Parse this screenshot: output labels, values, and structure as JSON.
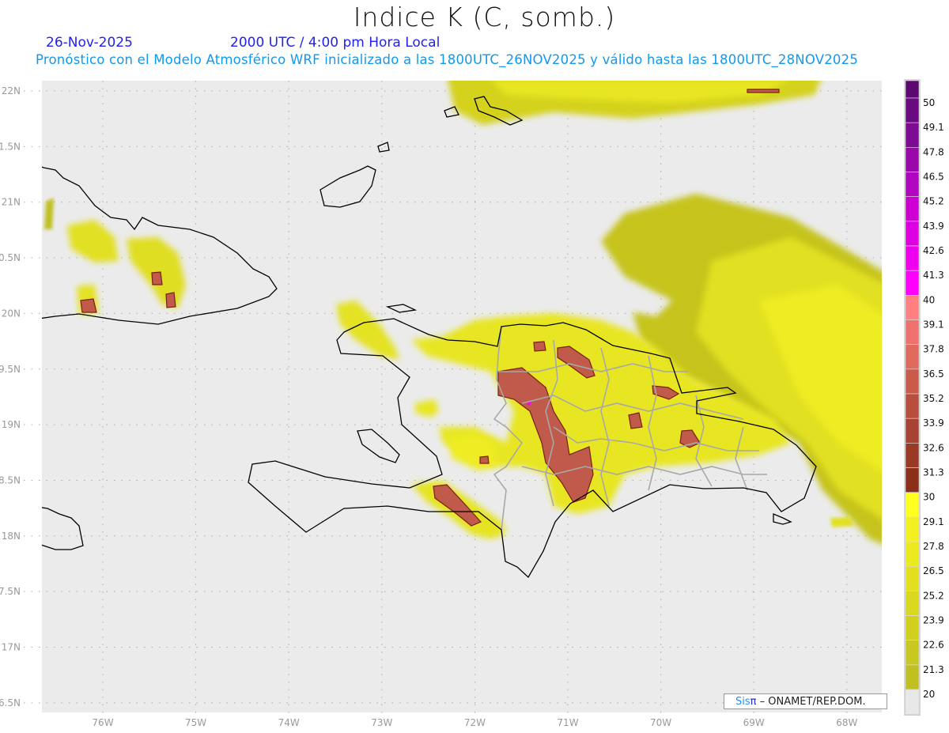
{
  "header": {
    "title": "Indice K (C, somb.)",
    "date": "26-Nov-2025",
    "time": "2000 UTC / 4:00 pm Hora Local",
    "subtitle": "Pronóstico con el Modelo Atmosférico WRF inicializado a las 1800UTC_26NOV2025 y válido hasta las  1800UTC_28NOV2025"
  },
  "map": {
    "lat_labels": [
      "22N",
      "1.5N",
      "21N",
      "0.5N",
      "20N",
      "9.5N",
      "19N",
      "8.5N",
      "18N",
      "7.5N",
      "17N",
      "6.5N"
    ],
    "lon_labels": [
      "76W",
      "75W",
      "74W",
      "73W",
      "72W",
      "71W",
      "70W",
      "69W",
      "68W"
    ],
    "ocean_color": "#ebebeb",
    "coast_color": "#000000",
    "province_color": "#a8a8a8"
  },
  "colorbar": {
    "labels": [
      "50",
      "49.1",
      "47.8",
      "46.5",
      "45.2",
      "43.9",
      "42.6",
      "41.3",
      "40",
      "39.1",
      "37.8",
      "36.5",
      "35.2",
      "33.9",
      "32.6",
      "31.3",
      "30",
      "29.1",
      "27.8",
      "26.5",
      "25.2",
      "23.9",
      "22.6",
      "21.3",
      "20"
    ],
    "colors": [
      "#5c0870",
      "#6a0a80",
      "#7c0a92",
      "#9a08aa",
      "#b006c0",
      "#cc00d2",
      "#dd00e2",
      "#ee00ee",
      "#ff00ff",
      "#ff8080",
      "#f07070",
      "#e06a5e",
      "#cc5a4a",
      "#b84e3e",
      "#a84232",
      "#983a26",
      "#8a3018",
      "#ffff20",
      "#f2f020",
      "#eaea1e",
      "#e2e01e",
      "#dad81e",
      "#d2d01e",
      "#c8c820",
      "#c0c020",
      "#e8e8e8"
    ]
  },
  "credit": {
    "sis": "Sis",
    "pi": "π",
    "org": " – ONAMET/REP.DOM."
  }
}
